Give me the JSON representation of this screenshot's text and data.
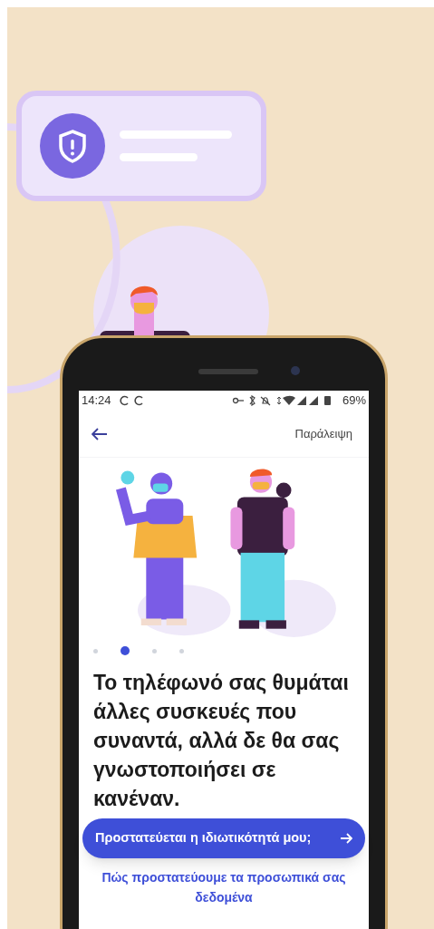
{
  "status_bar": {
    "time": "14:24",
    "battery": "69%"
  },
  "top_bar": {
    "skip": "Παράλειψη"
  },
  "pager": [
    {
      "selected": false
    },
    {
      "selected": true
    },
    {
      "selected": false
    },
    {
      "selected": false
    }
  ],
  "headline": "Το τηλέφωνό σας θυμάται άλλες συσκευές που συναντά, αλλά δε θα σας γνωστοποιήσει σε κανέναν.",
  "primary_button": {
    "label": "Προστατεύεται η ιδιωτικότητά μου;"
  },
  "link": "Πώς προστατεύουμε τα προσωπικά σας δεδομένα"
}
